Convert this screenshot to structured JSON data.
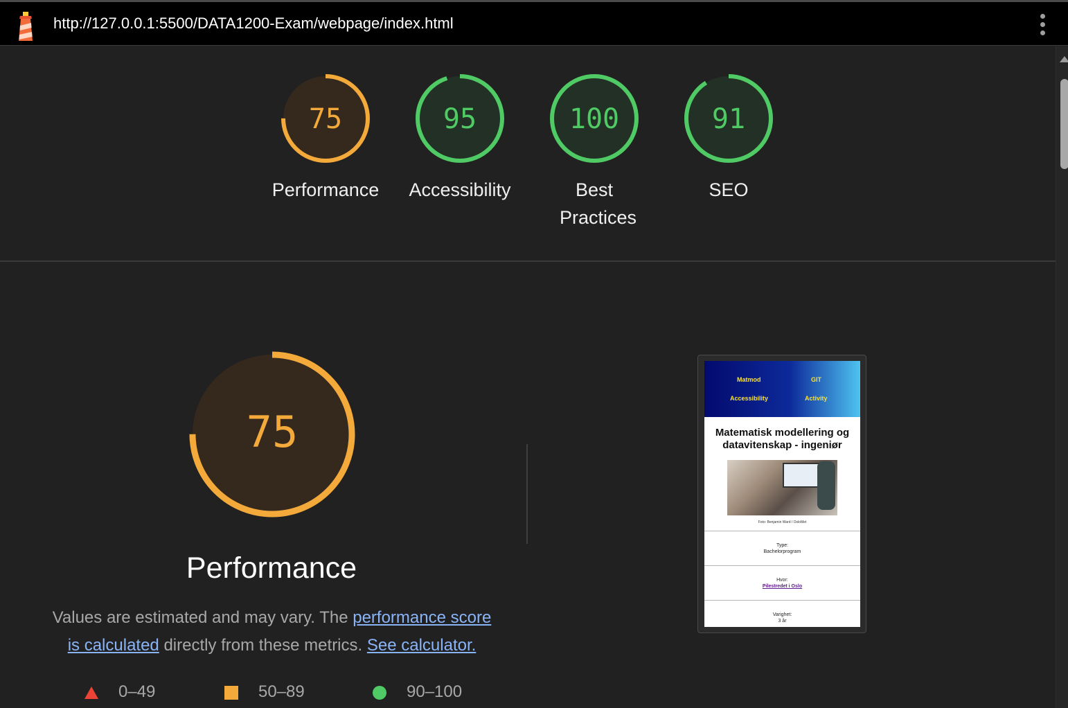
{
  "header": {
    "url": "http://127.0.0.1:5500/DATA1200-Exam/webpage/index.html",
    "logo_icon": "lighthouse-icon",
    "menu_icon": "kebab-menu-icon"
  },
  "summary": [
    {
      "score": "75",
      "value": 75,
      "label": "Performance",
      "color": "#f4a93b"
    },
    {
      "score": "95",
      "value": 95,
      "label": "Accessibility",
      "color": "#4fca64"
    },
    {
      "score": "100",
      "value": 100,
      "label": "Best Practices",
      "color": "#4fca64"
    },
    {
      "score": "91",
      "value": 91,
      "label": "SEO",
      "color": "#4fca64"
    }
  ],
  "performance": {
    "score": "75",
    "value": 75,
    "title": "Performance",
    "desc_prefix": "Values are estimated and may vary. The ",
    "desc_link1": "performance score is calculated",
    "desc_middle": " directly from these metrics. ",
    "desc_link2": "See calculator."
  },
  "legend": [
    {
      "range": "0–49",
      "shape": "triangle",
      "color": "#eb4335"
    },
    {
      "range": "50–89",
      "shape": "square",
      "color": "#f4a93b"
    },
    {
      "range": "90–100",
      "shape": "circle",
      "color": "#4fca64"
    }
  ],
  "screenshot": {
    "nav": [
      "Matmod",
      "GIT",
      "Accessibility",
      "Activity"
    ],
    "heading": "Matematisk modellering og datavitenskap - ingeniør",
    "caption": "Foto: Benjamin Ward / OsloMet",
    "rows": [
      {
        "label": "Type:",
        "value": "Bachelorprogram"
      },
      {
        "label": "Hvor:",
        "value": "Pilestredet i Oslo"
      },
      {
        "label": "Varighet:",
        "value": "3 år"
      }
    ]
  }
}
